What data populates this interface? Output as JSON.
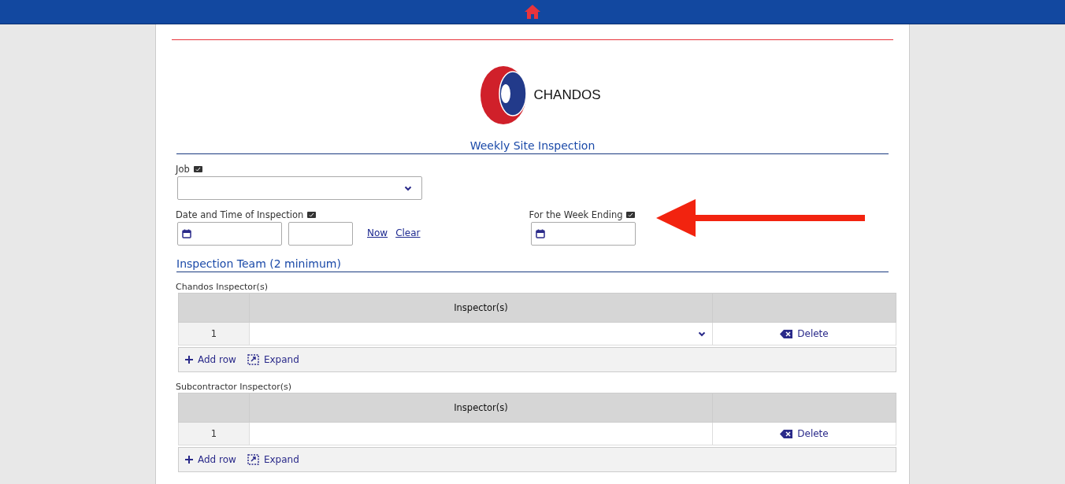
{
  "brand": {
    "name": "CHANDOS"
  },
  "form_title": "Weekly Site Inspection",
  "job": {
    "label": "Job"
  },
  "inspection_datetime": {
    "label": "Date and Time of Inspection",
    "links": [
      "Now",
      "Clear"
    ]
  },
  "week_ending": {
    "label": "For the Week Ending"
  },
  "team_heading": "Inspection Team (2 minimum)",
  "grids": [
    {
      "label": "Chandos Inspector(s)",
      "column": "Inspector(s)",
      "rows": [
        {
          "number": "1",
          "kind": "select"
        }
      ],
      "delete": "Delete",
      "add_row": "Add row",
      "expand": "Expand"
    },
    {
      "label": "Subcontractor Inspector(s)",
      "column": "Inspector(s)",
      "rows": [
        {
          "number": "1",
          "kind": "text"
        }
      ],
      "delete": "Delete",
      "add_row": "Add row",
      "expand": "Expand"
    }
  ]
}
